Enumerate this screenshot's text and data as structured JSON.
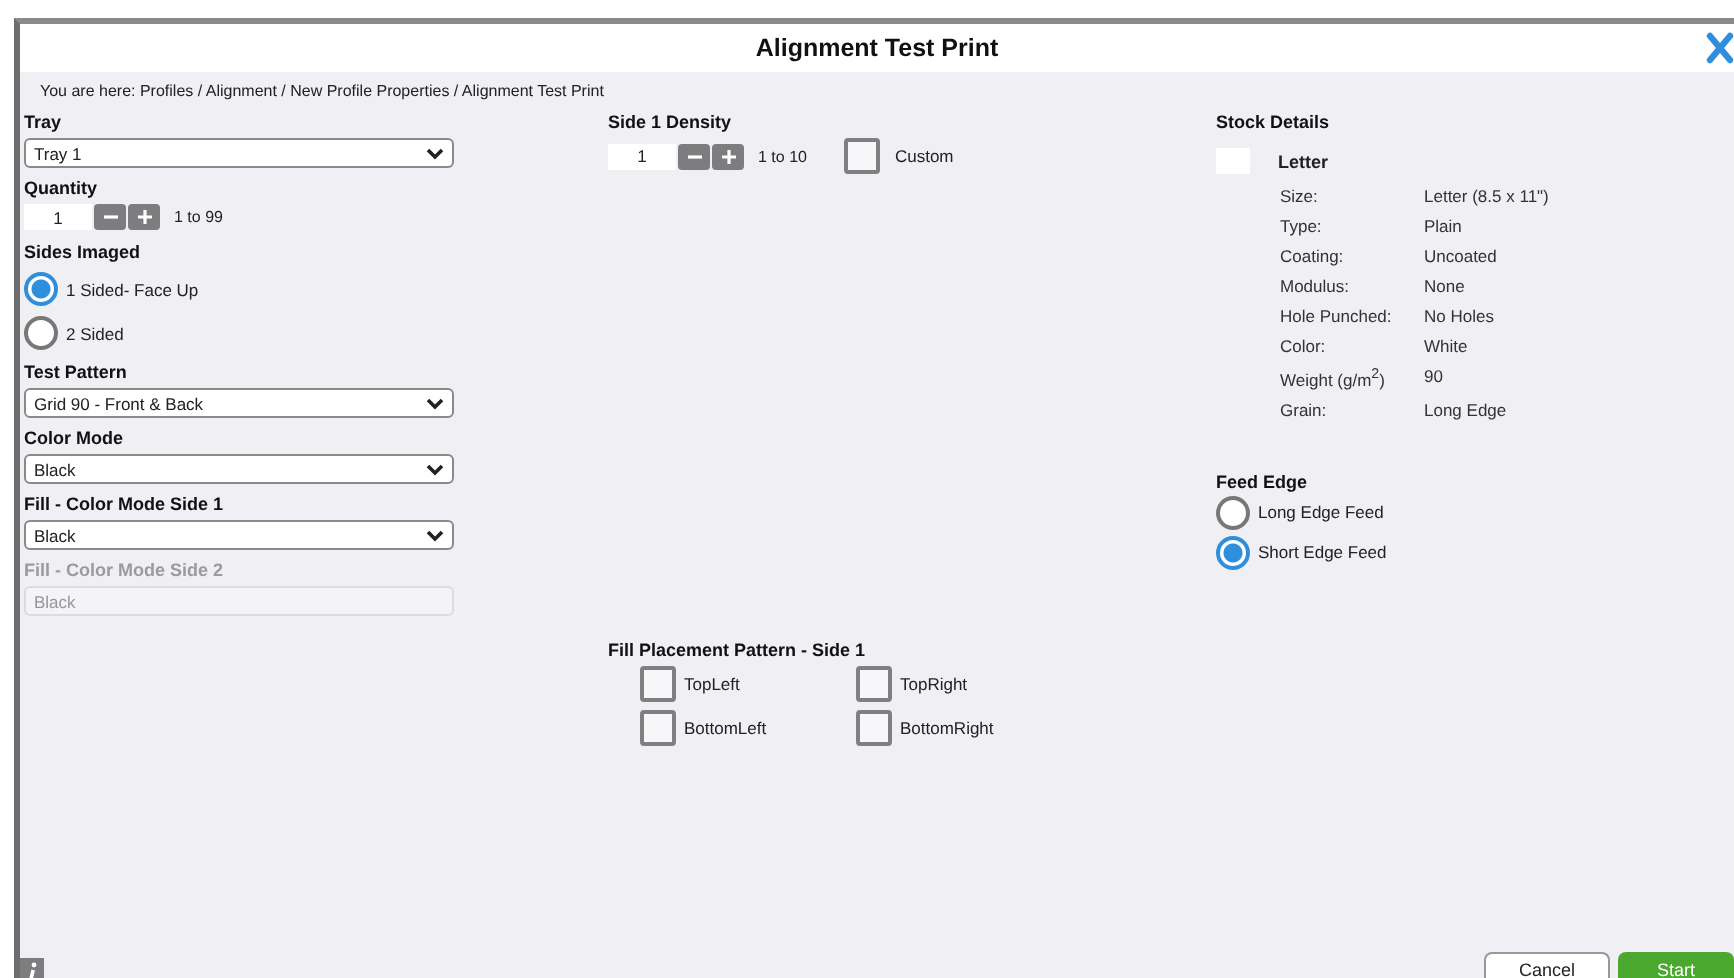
{
  "window": {
    "title": "Alignment Test Print"
  },
  "breadcrumb": "You are here: Profiles / Alignment / New Profile Properties / Alignment Test Print",
  "left_fields": [
    {
      "kind": "select",
      "label": "Tray",
      "value": "Tray 1",
      "disabled": false
    },
    {
      "kind": "stepper",
      "label": "Quantity",
      "value": "1",
      "range": "1 to 99"
    },
    {
      "kind": "radio",
      "label": "Sides Imaged",
      "options": [
        {
          "label": "1 Sided- Face Up",
          "selected": true
        },
        {
          "label": "2 Sided",
          "selected": false
        }
      ]
    },
    {
      "kind": "select",
      "label": "Test Pattern",
      "value": "Grid 90 - Front & Back",
      "disabled": false
    },
    {
      "kind": "select",
      "label": "Color Mode",
      "value": "Black",
      "disabled": false
    },
    {
      "kind": "select",
      "label": "Fill - Color Mode Side 1",
      "value": "Black",
      "disabled": false
    },
    {
      "kind": "select",
      "label": "Fill - Color Mode Side 2",
      "value": "Black",
      "disabled": true
    }
  ],
  "density": {
    "label": "Side 1 Density",
    "value": "1",
    "range": "1 to 10",
    "custom": {
      "label": "Custom",
      "checked": false
    }
  },
  "fill_placement": {
    "label": "Fill Placement Pattern - Side 1",
    "options": [
      {
        "label": "TopLeft",
        "checked": false
      },
      {
        "label": "TopRight",
        "checked": false
      },
      {
        "label": "BottomLeft",
        "checked": false
      },
      {
        "label": "BottomRight",
        "checked": false
      }
    ]
  },
  "stock": {
    "heading": "Stock Details",
    "name": "Letter",
    "details": [
      {
        "label": "Size:",
        "value": "Letter (8.5 x 11\")"
      },
      {
        "label": "Type:",
        "value": "Plain"
      },
      {
        "label": "Coating:",
        "value": "Uncoated"
      },
      {
        "label": "Modulus:",
        "value": "None"
      },
      {
        "label": "Hole Punched:",
        "value": "No Holes"
      },
      {
        "label": "Color:",
        "value": "White"
      },
      {
        "label": "Weight (g/m$^{2}$)",
        "value": "90"
      },
      {
        "label": "Grain:",
        "value": "Long Edge"
      }
    ]
  },
  "feed_edge": {
    "label": "Feed Edge",
    "options": [
      {
        "label": "Long Edge Feed",
        "selected": false
      },
      {
        "label": "Short Edge Feed",
        "selected": true
      }
    ]
  },
  "buttons": [
    {
      "kind": "secondary",
      "label": "Cancel"
    },
    {
      "kind": "primary",
      "label": "Start"
    }
  ]
}
